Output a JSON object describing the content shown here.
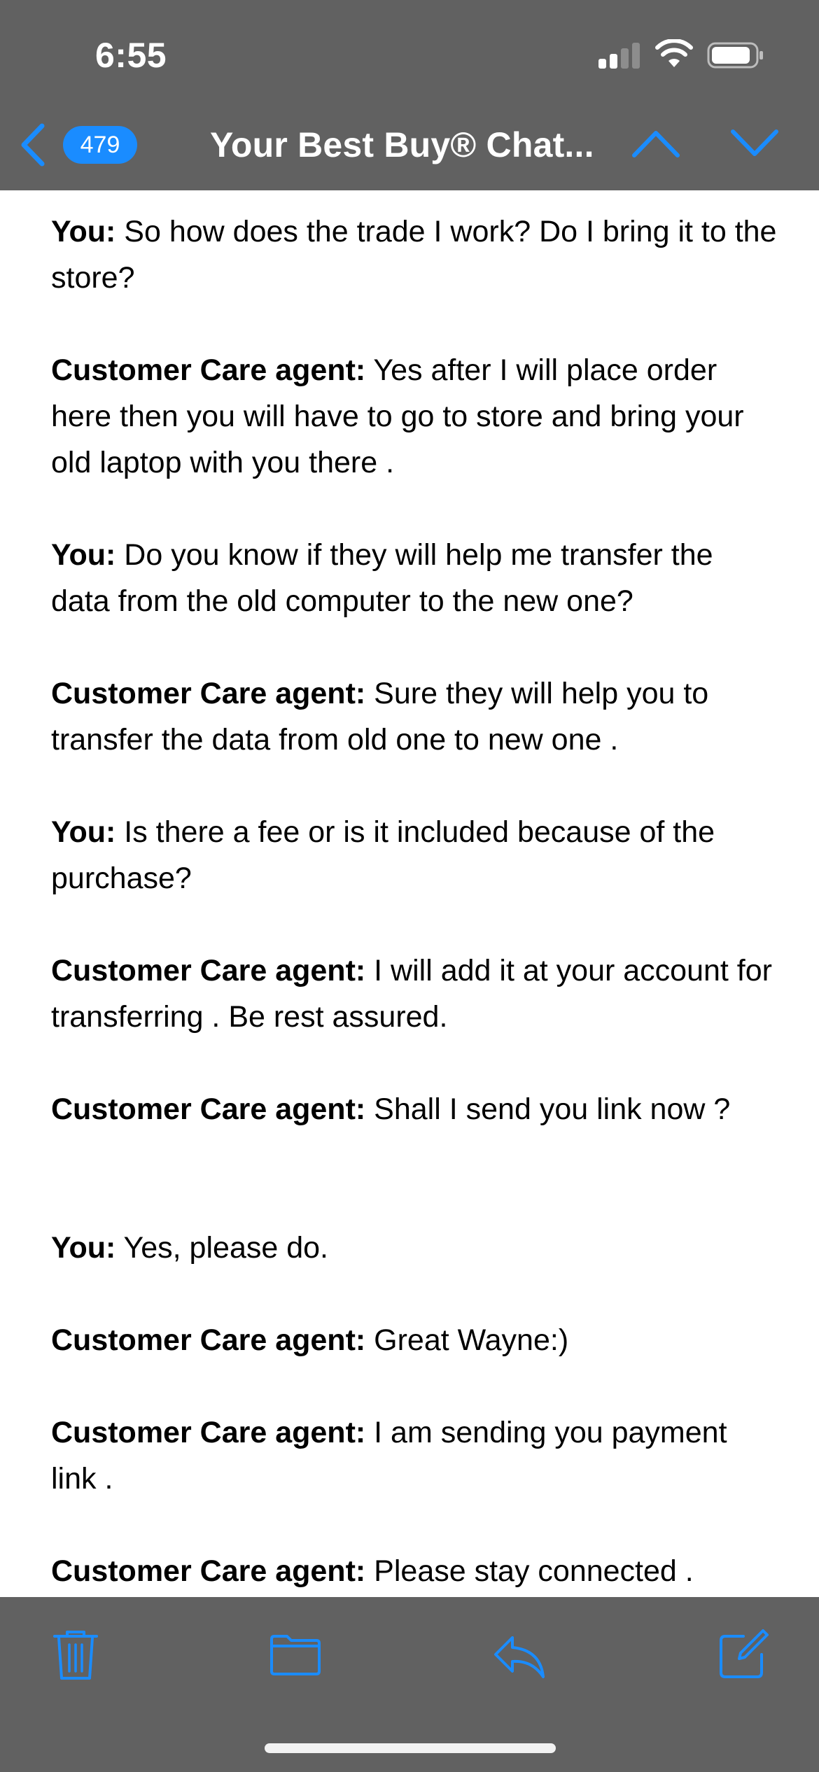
{
  "status_bar": {
    "time": "6:55",
    "icons": [
      "cellular-signal-icon",
      "wifi-icon",
      "battery-icon"
    ]
  },
  "nav_bar": {
    "back_icon": "chevron-left-icon",
    "unread_count": "479",
    "title": "Your Best Buy® Chat...",
    "prev_icon": "chevron-up-icon",
    "next_icon": "chevron-down-icon"
  },
  "messages": [
    {
      "speaker": "You:",
      "text": " So how does the trade I work? Do I bring it to the store?"
    },
    {
      "speaker": "Customer Care agent:",
      "text": " Yes after I will place order here then you will have to go to store and bring your old laptop with you there ."
    },
    {
      "speaker": "You:",
      "text": " Do you know if they will help me transfer the data from the old computer to the new one?"
    },
    {
      "speaker": "Customer Care agent:",
      "text": " Sure they will help you to transfer the data from old one to new one ."
    },
    {
      "speaker": "You:",
      "text": " Is there a fee or is it included because of the purchase?"
    },
    {
      "speaker": "Customer Care agent:",
      "text": " I will add it at your account for transferring . Be rest assured."
    },
    {
      "speaker": "Customer Care agent:",
      "text": " Shall I send you link now ?"
    },
    {
      "speaker": "You:",
      "text": " Yes, please do."
    },
    {
      "speaker": "Customer Care agent:",
      "text": " Great Wayne:)"
    },
    {
      "speaker": "Customer Care agent:",
      "text": " I am sending you payment link ."
    },
    {
      "speaker": "Customer Care agent:",
      "text": " Please stay connected ."
    }
  ],
  "toolbar": {
    "items": [
      "trash-icon",
      "folder-icon",
      "reply-icon",
      "compose-icon"
    ]
  },
  "colors": {
    "bar_background": "#616161",
    "accent": "#1a8cff",
    "badge": "#1a8cff"
  }
}
